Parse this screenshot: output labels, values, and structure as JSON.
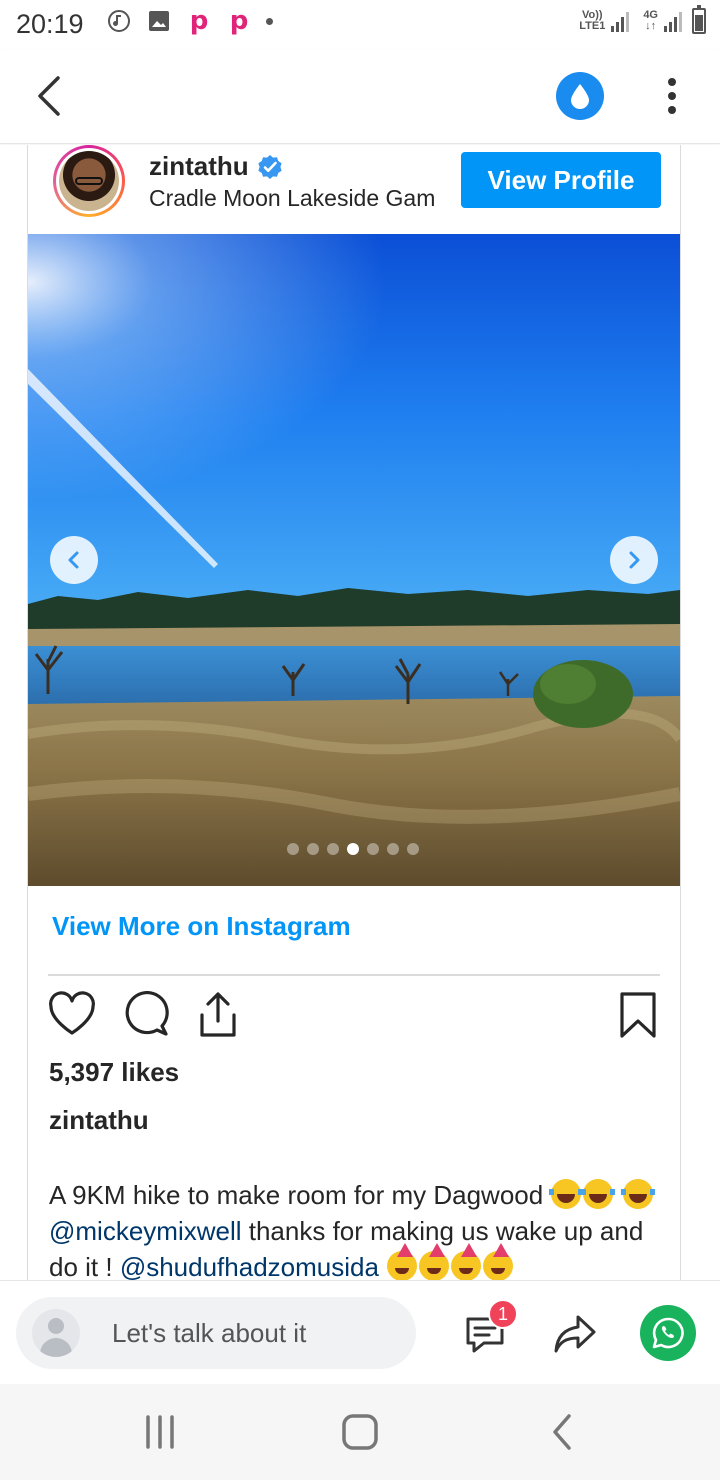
{
  "status_bar": {
    "time": "20:19",
    "network_1_top": "Vo))",
    "network_1_bottom": "LTE1",
    "network_2_top": "4G",
    "network_2_bottom": "↓↑"
  },
  "app_bar": {
    "back_icon": "chevron-left-icon",
    "drop_icon": "water-drop-icon",
    "more_icon": "vertical-dots-icon"
  },
  "post": {
    "username": "zintathu",
    "verified": true,
    "location": "Cradle Moon Lakeside Gam",
    "view_profile_label": "View Profile",
    "carousel": {
      "total_slides": 7,
      "active_slide": 4
    },
    "view_more_label": "View More on Instagram",
    "likes": "5,397 likes",
    "caption_user": "zintathu",
    "caption": {
      "part1": "A 9KM hike to make room for my Dagwood",
      "mention1": "@mickeymixwell",
      "part2": " thanks for making us wake up and do it ! ",
      "mention2": "@shudufhadzomusida"
    }
  },
  "comment_bar": {
    "placeholder": "Let's talk about it",
    "comment_count": "1"
  },
  "colors": {
    "accent": "#0095f6",
    "drop_button": "#1a8cf0",
    "badge": "#f0435a",
    "whatsapp": "#18b35c",
    "mention": "#00376b"
  }
}
